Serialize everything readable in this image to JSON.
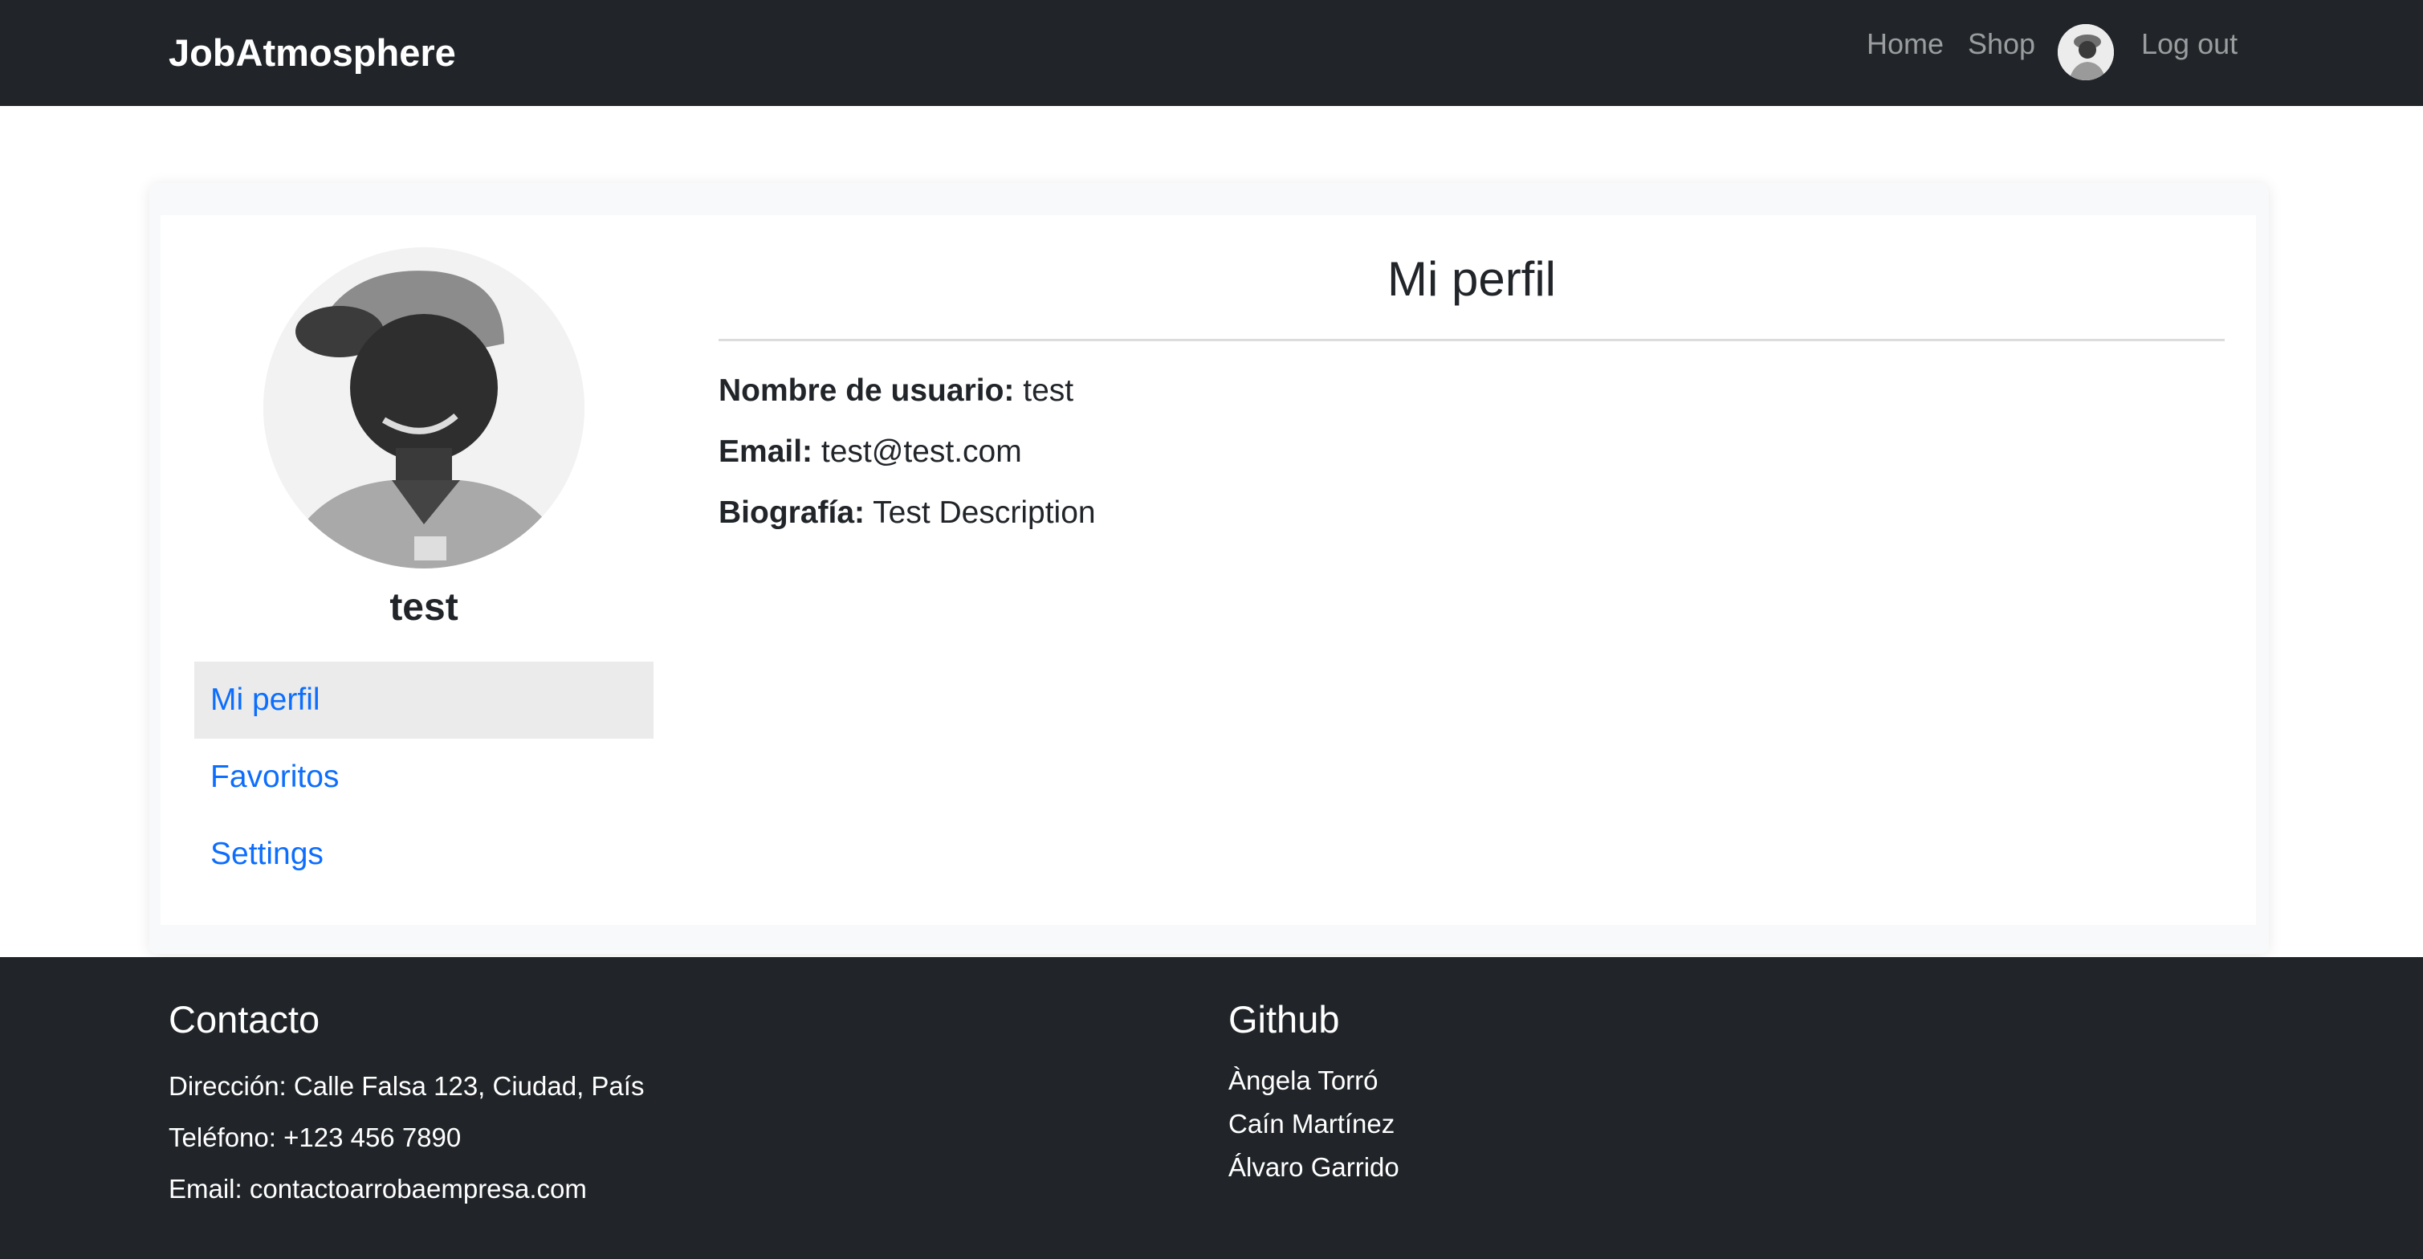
{
  "navbar": {
    "brand": "JobAtmosphere",
    "links": {
      "home": "Home",
      "shop": "Shop",
      "logout": "Log out"
    },
    "avatar_icon": "user-avatar-photo"
  },
  "profile": {
    "username": "test",
    "sidebar": {
      "mi_perfil": "Mi perfil",
      "favoritos": "Favoritos",
      "settings": "Settings"
    },
    "section_title": "Mi perfil",
    "fields": {
      "username_label": "Nombre de usuario:",
      "username_value": "test",
      "email_label": "Email:",
      "email_value": "test@test.com",
      "bio_label": "Biografía:",
      "bio_value": "Test Description"
    }
  },
  "footer": {
    "contact": {
      "heading": "Contacto",
      "address": "Dirección: Calle Falsa 123, Ciudad, País",
      "phone": "Teléfono: +123 456 7890",
      "email": "Email: contactoarrobaempresa.com"
    },
    "github": {
      "heading": "Github",
      "members": [
        "Àngela Torró",
        "Caín Martínez",
        "Álvaro Garrido"
      ]
    }
  },
  "colors": {
    "navbar_bg": "#212529",
    "link_blue": "#0d6efd",
    "active_item_bg": "#ebebeb",
    "footer_bg": "#212529"
  }
}
